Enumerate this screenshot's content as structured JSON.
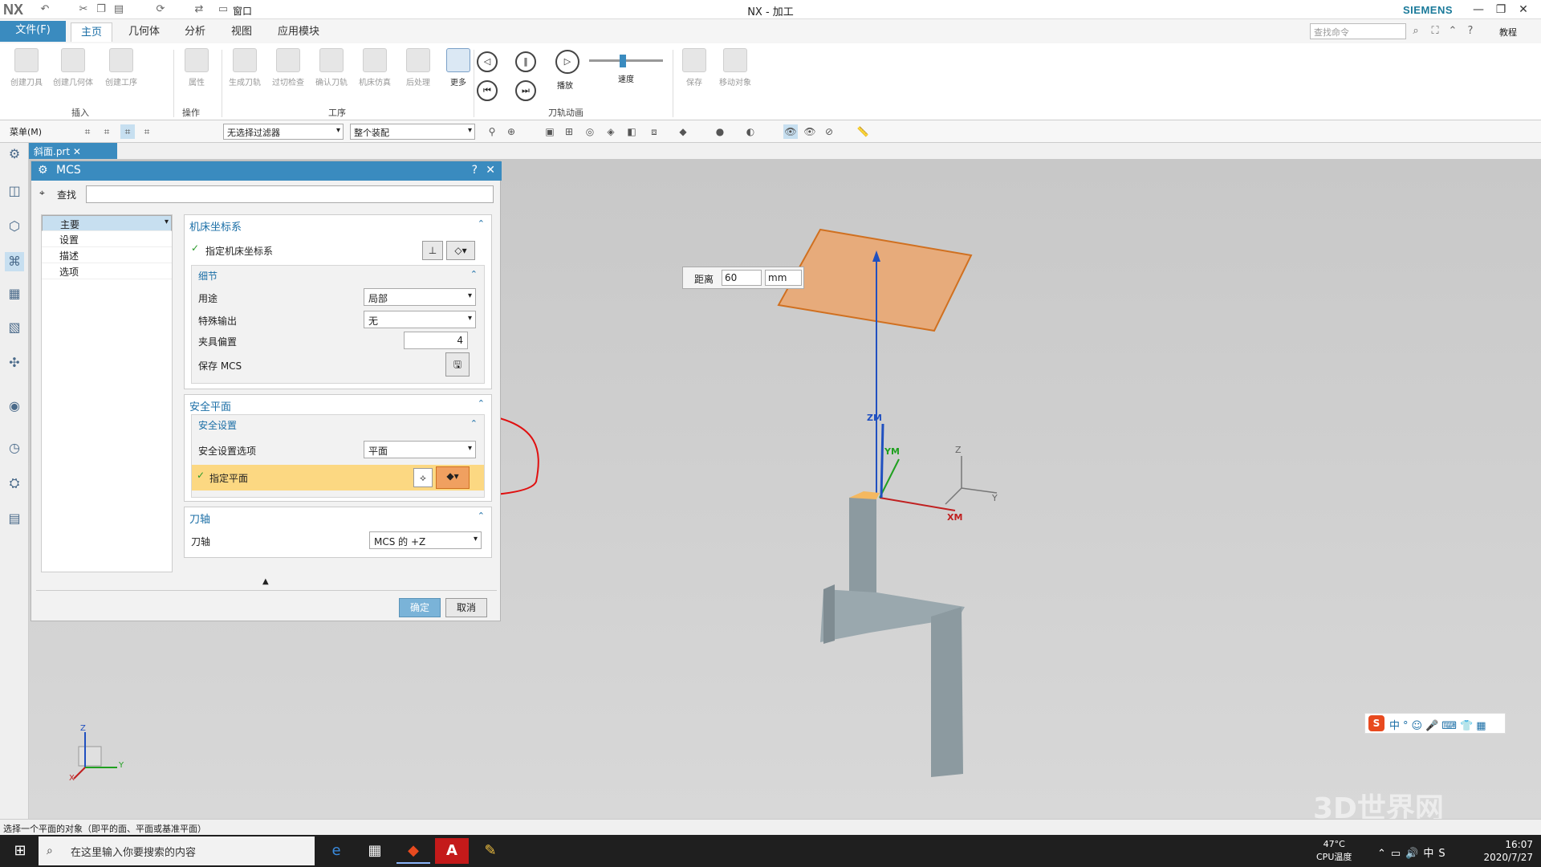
{
  "titlebar": {
    "logo": "NX",
    "title": "NX - 加工",
    "brand": "SIEMENS",
    "window_menu": "窗口"
  },
  "tabs": {
    "file": "文件(F)",
    "items": [
      "主页",
      "几何体",
      "分析",
      "视图",
      "应用模块"
    ],
    "active": "主页",
    "search_placeholder": "查找命令",
    "tutorial": "教程"
  },
  "ribbon": {
    "insert": {
      "buttons": [
        "创建刀具",
        "创建几何体",
        "创建工序"
      ],
      "label": "插入"
    },
    "ops": {
      "buttons": [
        "属性"
      ],
      "label": "操作"
    },
    "process": {
      "buttons": [
        "生成刀轨",
        "过切检查",
        "确认刀轨",
        "机床仿真",
        "后处理"
      ],
      "more": "更多",
      "label": "工序"
    },
    "anim": {
      "play": "播放",
      "speed": "速度",
      "label": "刀轨动画"
    },
    "other": {
      "save": "保存",
      "move": "移动对象"
    }
  },
  "toolbar2": {
    "menu": "菜单(M)",
    "filter": "无选择过滤器",
    "assembly": "整个装配"
  },
  "file_tab": "斜面.prt",
  "dialog": {
    "title": "MCS",
    "find_label": "查找",
    "nav": [
      "主要",
      "设置",
      "描述",
      "选项"
    ],
    "mcs_section": {
      "title": "机床坐标系",
      "specify": "指定机床坐标系"
    },
    "details": {
      "title": "细节",
      "purpose_label": "用途",
      "purpose_value": "局部",
      "special_label": "特殊输出",
      "special_value": "无",
      "fixture_label": "夹具偏置",
      "fixture_value": "4",
      "save_label": "保存 MCS"
    },
    "clearance": {
      "title": "安全平面",
      "settings_title": "安全设置",
      "option_label": "安全设置选项",
      "option_value": "平面",
      "specify_plane": "指定平面"
    },
    "tool_axis": {
      "title": "刀轴",
      "label": "刀轴",
      "value": "MCS 的 +Z"
    },
    "ok": "确定",
    "cancel": "取消"
  },
  "distance_box": {
    "label": "距离",
    "value": "60",
    "unit": "mm"
  },
  "axes": {
    "zm": "ZM",
    "ym": "YM",
    "xm": "XM",
    "z": "Z",
    "y": "Y",
    "x": "X"
  },
  "statusbar": "选择一个平面的对象（即平的面、平面或基准平面）",
  "taskbar": {
    "search": "在这里输入你要搜索的内容",
    "temp": "47°C",
    "temp_label": "CPU温度",
    "time": "16:07",
    "date": "2020/7/27"
  },
  "watermark": "3D世界网",
  "colors": {
    "accent": "#3a8bbf",
    "plane": "#f0a060",
    "highlight": "#fcd882",
    "annotation": "#e01010"
  }
}
